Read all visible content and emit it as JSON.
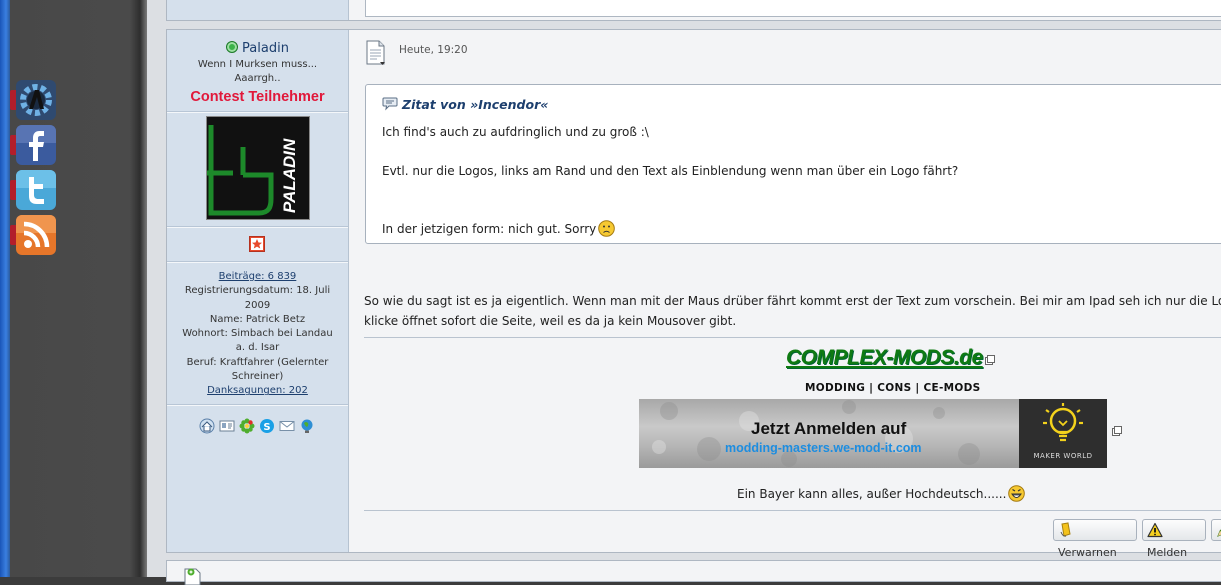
{
  "social_buttons": [
    {
      "name": "we-mod-it",
      "color": "#2f4a70"
    },
    {
      "name": "facebook",
      "color": "#3b5b9e"
    },
    {
      "name": "twitter",
      "color": "#4aa8d8"
    },
    {
      "name": "rss",
      "color": "#e6762a"
    }
  ],
  "user": {
    "username": "Paladin",
    "online": true,
    "user_title": "Wenn I Murksen muss... Aaarrgh..",
    "rank_label": "Contest Teilnehmer",
    "avatar_text": "PALADIN",
    "profile": {
      "posts": "Beiträge: 6 839",
      "registered": "Registrierungsdatum: 18. Juli 2009",
      "name": "Name: Patrick Betz",
      "residence": "Wohnort: Simbach bei Landau a. d. Isar",
      "job": "Beruf: Kraftfahrer (Gelernter Schreiner)",
      "thanks": "Danksagungen: 202"
    }
  },
  "post": {
    "time": "Heute, 19:20",
    "quote": {
      "header": "Zitat von »Incendor«",
      "line1": "Ich find's auch zu aufdringlich und zu groß :\\",
      "line2": "Evtl. nur die Logos, links am Rand und den Text als Einblendung wenn man über ein Logo fährt?",
      "line3": "In der jetzigen form: nich gut. Sorry"
    },
    "reply_line1": "So wie du sagt ist es ja eigentlich. Wenn man mit der Maus drüber fährt kommt erst der Text zum vorschein. Bei mir am Ipad seh ich nur die Logos",
    "reply_line2": "klicke öffnet sofort die Seite, weil es da ja kein Mousover gibt.",
    "signature": {
      "brand": "COMPLEX-MODS.de",
      "subtitle": "MODDING | CONS | CE-MODS",
      "banner_line1": "Jetzt Anmelden auf",
      "banner_line2": "modding-masters.we-mod-it.com",
      "banner_logo_text": "MAKER WORLD",
      "text": "Ein Bayer kann alles, außer Hochdeutsch......"
    }
  },
  "actions": {
    "warn": "Verwarnen",
    "report": "Melden"
  },
  "colors": {
    "accent_link": "#1d3f6e",
    "rank_red": "#e1183a",
    "brand_green": "#0f7a12",
    "banner_blue": "#1d8de0"
  }
}
